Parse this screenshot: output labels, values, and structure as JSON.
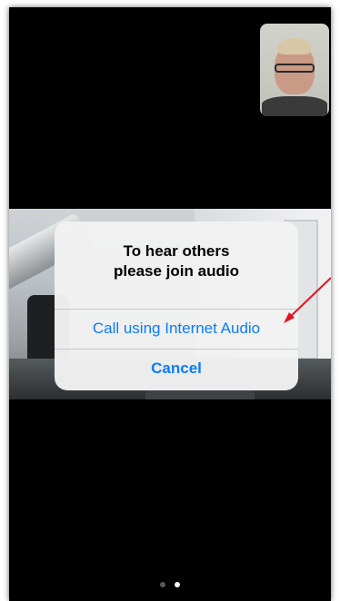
{
  "dialog": {
    "title": "To hear others\nplease join audio",
    "primary_action": "Call using Internet Audio",
    "cancel_action": "Cancel"
  },
  "pager": {
    "total": 2,
    "current": 2
  },
  "colors": {
    "screen_background": "#000000",
    "dialog_background": "#f2f2f2",
    "action_blue": "#0a7cff",
    "annotation_red": "#e0141e"
  },
  "icons": {
    "annotation": "red-arrow-pointer"
  }
}
